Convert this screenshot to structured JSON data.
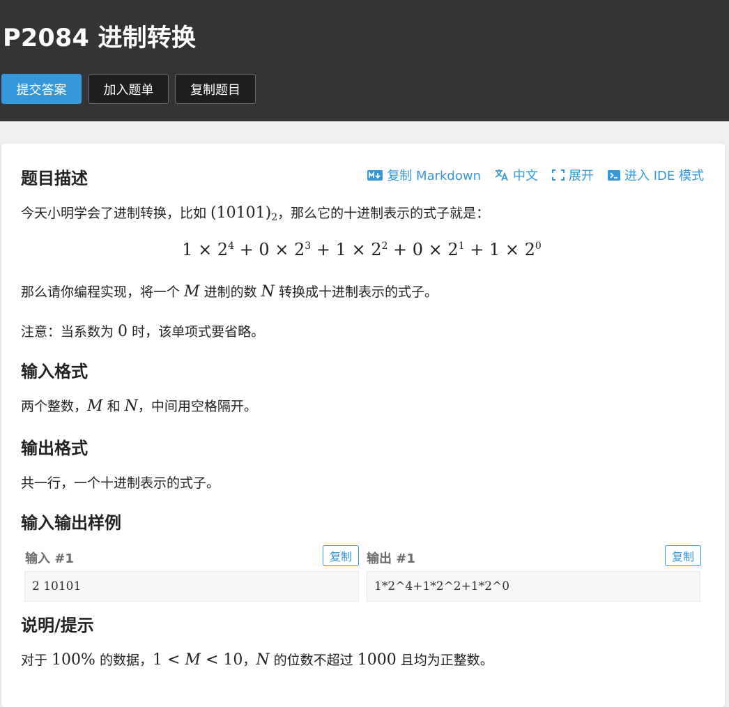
{
  "header": {
    "title": "P2084 进制转换",
    "buttons": {
      "submit": "提交答案",
      "add_to_list": "加入题单",
      "copy_problem": "复制题目"
    }
  },
  "toolbar": {
    "copy_markdown": "复制 Markdown",
    "language": "中文",
    "expand": "展开",
    "ide_mode": "进入 IDE 模式"
  },
  "description": {
    "heading": "题目描述",
    "intro_before": "今天小明学会了进制转换，比如 ",
    "intro_number": "(10101)",
    "intro_base": "2",
    "intro_after": "，那么它的十进制表示的式子就是：",
    "formula": "1 × 2^4 + 0 × 2^3 + 1 × 2^2 + 0 × 2^1 + 1 × 2^0",
    "task_a": "那么请你编程实现，将一个 ",
    "task_m": "M",
    "task_b": " 进制的数 ",
    "task_n": "N",
    "task_c": " 转换成十进制表示的式子。",
    "note_a": "注意：当系数为 ",
    "note_zero": "0",
    "note_b": " 时，该单项式要省略。"
  },
  "input_format": {
    "heading": "输入格式",
    "text_a": "两个整数，",
    "m": "M",
    "text_b": " 和 ",
    "n": "N",
    "text_c": "，中间用空格隔开。"
  },
  "output_format": {
    "heading": "输出格式",
    "text": "共一行，一个十进制表示的式子。"
  },
  "samples": {
    "heading": "输入输出样例",
    "input_label": "输入 #1",
    "output_label": "输出 #1",
    "copy_label": "复制",
    "input_value": "2 10101",
    "output_value": "1*2^4+1*2^2+1*2^0"
  },
  "hint": {
    "heading": "说明/提示",
    "text_a": "对于 ",
    "percent": "100%",
    "text_b": " 的数据，",
    "constraint": "1 < M < 10",
    "text_c": "，",
    "n": "N",
    "text_d": " 的位数不超过 ",
    "limit": "1000",
    "text_e": " 且均为正整数。"
  },
  "colors": {
    "header_bg": "#333436",
    "accent": "#3498db",
    "page_bg": "#efefef"
  }
}
